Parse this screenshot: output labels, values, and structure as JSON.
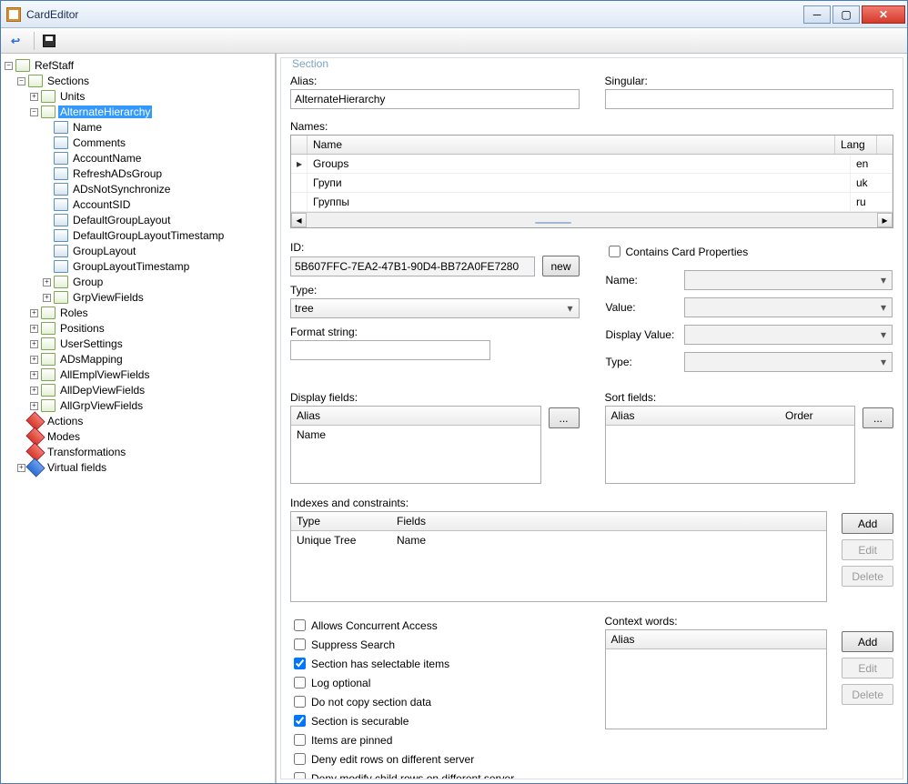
{
  "window": {
    "title": "CardEditor"
  },
  "toolbar": {
    "back_tip": "Back",
    "save_tip": "Save"
  },
  "tree": {
    "root": "RefStaff",
    "sections": "Sections",
    "units": "Units",
    "althier": "AlternateHierarchy",
    "althier_children": [
      "Name",
      "Comments",
      "AccountName",
      "RefreshADsGroup",
      "ADsNotSynchronize",
      "AccountSID",
      "DefaultGroupLayout",
      "DefaultGroupLayoutTimestamp",
      "GroupLayout",
      "GroupLayoutTimestamp",
      "Group",
      "GrpViewFields"
    ],
    "after_sections": [
      "Roles",
      "Positions",
      "UserSettings",
      "ADsMapping",
      "AllEmplViewFields",
      "AllDepViewFields",
      "AllGrpViewFields"
    ],
    "actions": "Actions",
    "modes": "Modes",
    "transforms": "Transformations",
    "virtual": "Virtual fields"
  },
  "section": {
    "group_title": "Section",
    "alias_label": "Alias:",
    "alias_value": "AlternateHierarchy",
    "singular_label": "Singular:",
    "singular_value": "",
    "names_label": "Names:",
    "names_col_name": "Name",
    "names_col_lang": "Lang",
    "names_rows": [
      {
        "name": "Groups",
        "lang": "en"
      },
      {
        "name": "Групи",
        "lang": "uk"
      },
      {
        "name": "Группы",
        "lang": "ru"
      }
    ],
    "id_label": "ID:",
    "id_value": "5B607FFC-7EA2-47B1-90D4-BB72A0FE7280",
    "new_btn": "new",
    "type_label": "Type:",
    "type_value": "tree",
    "format_label": "Format string:",
    "format_value": "",
    "cardprops_chk": "Contains Card Properties",
    "cardprops_name": "Name:",
    "cardprops_value": "Value:",
    "cardprops_display": "Display Value:",
    "cardprops_type": "Type:",
    "displayfields_label": "Display fields:",
    "displayfields_col": "Alias",
    "displayfields_rows": [
      "Name"
    ],
    "sortfields_label": "Sort fields:",
    "sortfields_col_alias": "Alias",
    "sortfields_col_order": "Order",
    "ellipsis": "...",
    "indexes_label": "Indexes and constraints:",
    "indexes_col_type": "Type",
    "indexes_col_fields": "Fields",
    "indexes_rows": [
      {
        "type": "Unique Tree",
        "fields": "Name"
      }
    ],
    "add_btn": "Add",
    "edit_btn": "Edit",
    "delete_btn": "Delete",
    "checkboxes": [
      {
        "label": "Allows Concurrent Access",
        "checked": false
      },
      {
        "label": "Suppress Search",
        "checked": false
      },
      {
        "label": "Section has selectable items",
        "checked": true
      },
      {
        "label": "Log optional",
        "checked": false
      },
      {
        "label": "Do not copy section data",
        "checked": false
      },
      {
        "label": "Section is securable",
        "checked": true
      },
      {
        "label": "Items are pinned",
        "checked": false
      },
      {
        "label": "Deny edit rows on different server",
        "checked": false
      },
      {
        "label": "Deny modify child rows on different server",
        "checked": false
      }
    ],
    "context_label": "Context words:",
    "context_col": "Alias"
  }
}
